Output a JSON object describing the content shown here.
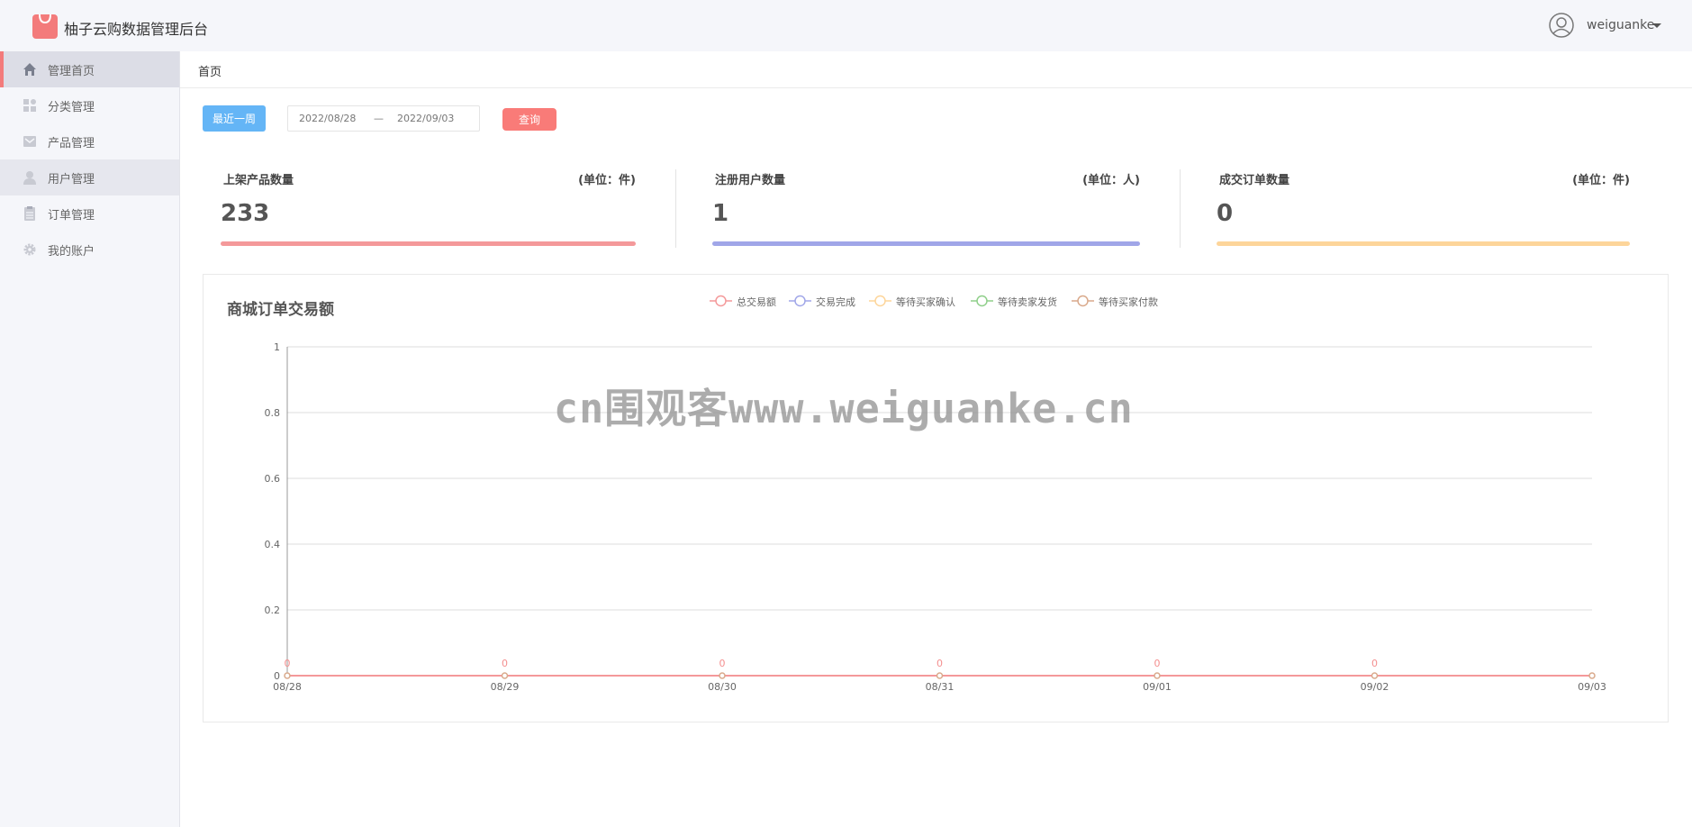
{
  "app": {
    "title": "柚子云购数据管理后台",
    "logo_icon": "shopping-bag-icon",
    "accent_color": "#f37b7b"
  },
  "user": {
    "name": "weiguanke",
    "avatar_icon": "user-avatar-icon"
  },
  "sidebar": {
    "items": [
      {
        "label": "管理首页",
        "icon": "home-icon",
        "state": "active"
      },
      {
        "label": "分类管理",
        "icon": "category-icon",
        "state": ""
      },
      {
        "label": "产品管理",
        "icon": "product-icon",
        "state": ""
      },
      {
        "label": "用户管理",
        "icon": "user-icon",
        "state": "hover"
      },
      {
        "label": "订单管理",
        "icon": "order-icon",
        "state": ""
      },
      {
        "label": "我的账户",
        "icon": "gear-icon",
        "state": ""
      }
    ]
  },
  "breadcrumb": "首页",
  "filter": {
    "week_button": "最近一周",
    "start_date": "2022/08/28",
    "separator": "—",
    "end_date": "2022/09/03",
    "query_button": "查询"
  },
  "stats": [
    {
      "label": "上架产品数量",
      "unit": "(单位：件)",
      "value": "233",
      "color": "#f4999a"
    },
    {
      "label": "注册用户数量",
      "unit": "(单位：人)",
      "value": "1",
      "color": "#a0a6e8"
    },
    {
      "label": "成交订单数量",
      "unit": "(单位：件)",
      "value": "0",
      "color": "#fdd59a"
    }
  ],
  "chart_data": {
    "type": "line",
    "title": "商城订单交易额",
    "categories": [
      "08/28",
      "08/29",
      "08/30",
      "08/31",
      "09/01",
      "09/02",
      "09/03"
    ],
    "series": [
      {
        "name": "总交易额",
        "color": "#f4999a",
        "values": [
          0,
          0,
          0,
          0,
          0,
          0,
          0
        ]
      },
      {
        "name": "交易完成",
        "color": "#a0a6e8",
        "values": [
          0,
          0,
          0,
          0,
          0,
          0,
          0
        ]
      },
      {
        "name": "等待买家确认",
        "color": "#fdd59a",
        "values": [
          0,
          0,
          0,
          0,
          0,
          0,
          0
        ]
      },
      {
        "name": "等待卖家发货",
        "color": "#8fcf8a",
        "values": [
          0,
          0,
          0,
          0,
          0,
          0,
          0
        ]
      },
      {
        "name": "等待买家付款",
        "color": "#d9a98b",
        "values": [
          0,
          0,
          0,
          0,
          0,
          0,
          0
        ]
      }
    ],
    "data_labels": [
      "0",
      "0",
      "0",
      "0",
      "0",
      "0"
    ],
    "yticks": [
      "0",
      "0.2",
      "0.4",
      "0.6",
      "0.8",
      "1"
    ],
    "ylim": [
      0,
      1
    ],
    "grid": true,
    "legend": "top-center"
  },
  "watermark": "cn围观客www.weiguanke.cn"
}
